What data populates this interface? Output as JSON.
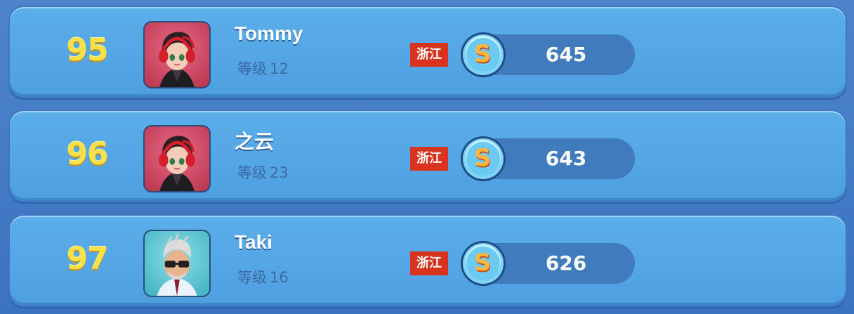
{
  "leaderboard": {
    "rows": [
      {
        "rank": "95",
        "name": "Tommy",
        "level_label": "等级",
        "level_value": "12",
        "region": "浙江",
        "score": "645",
        "avatar": "red-headphones-girl-avatar"
      },
      {
        "rank": "96",
        "name": "之云",
        "level_label": "等级",
        "level_value": "23",
        "region": "浙江",
        "score": "643",
        "avatar": "red-headphones-girl-avatar"
      },
      {
        "rank": "97",
        "name": "Taki",
        "level_label": "等级",
        "level_value": "16",
        "region": "浙江",
        "score": "626",
        "avatar": "sunglasses-old-man-avatar"
      }
    ],
    "coin_icon": "s-coin-icon",
    "colors": {
      "row_bg": "#55a7e6",
      "rank_gold": "#f7e14a",
      "region_red": "#d8331f",
      "score_pill": "#3f7bbd",
      "level_text": "#3b6aa5"
    }
  }
}
